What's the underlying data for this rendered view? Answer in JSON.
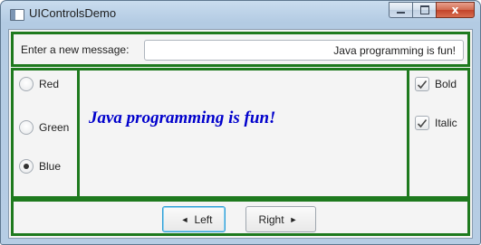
{
  "window": {
    "title": "UIControlsDemo",
    "caption": {
      "close_glyph": "x"
    }
  },
  "top": {
    "message_label": "Enter a new message:",
    "message_value": "Java programming is fun!"
  },
  "colors": {
    "items": [
      {
        "label": "Red",
        "checked": false
      },
      {
        "label": "Green",
        "checked": false
      },
      {
        "label": "Blue",
        "checked": true
      }
    ]
  },
  "display": {
    "text": "Java programming is fun!",
    "color": "#0000cc",
    "bold": true,
    "italic": true
  },
  "styles": {
    "items": [
      {
        "label": "Bold",
        "checked": true
      },
      {
        "label": "Italic",
        "checked": true
      }
    ]
  },
  "buttons": {
    "left_label": "Left",
    "right_label": "Right",
    "left_arrow": "◄",
    "right_arrow": "►"
  },
  "theme": {
    "pane_border": "#1e7a1e",
    "focus_border": "#2f9fd6"
  }
}
